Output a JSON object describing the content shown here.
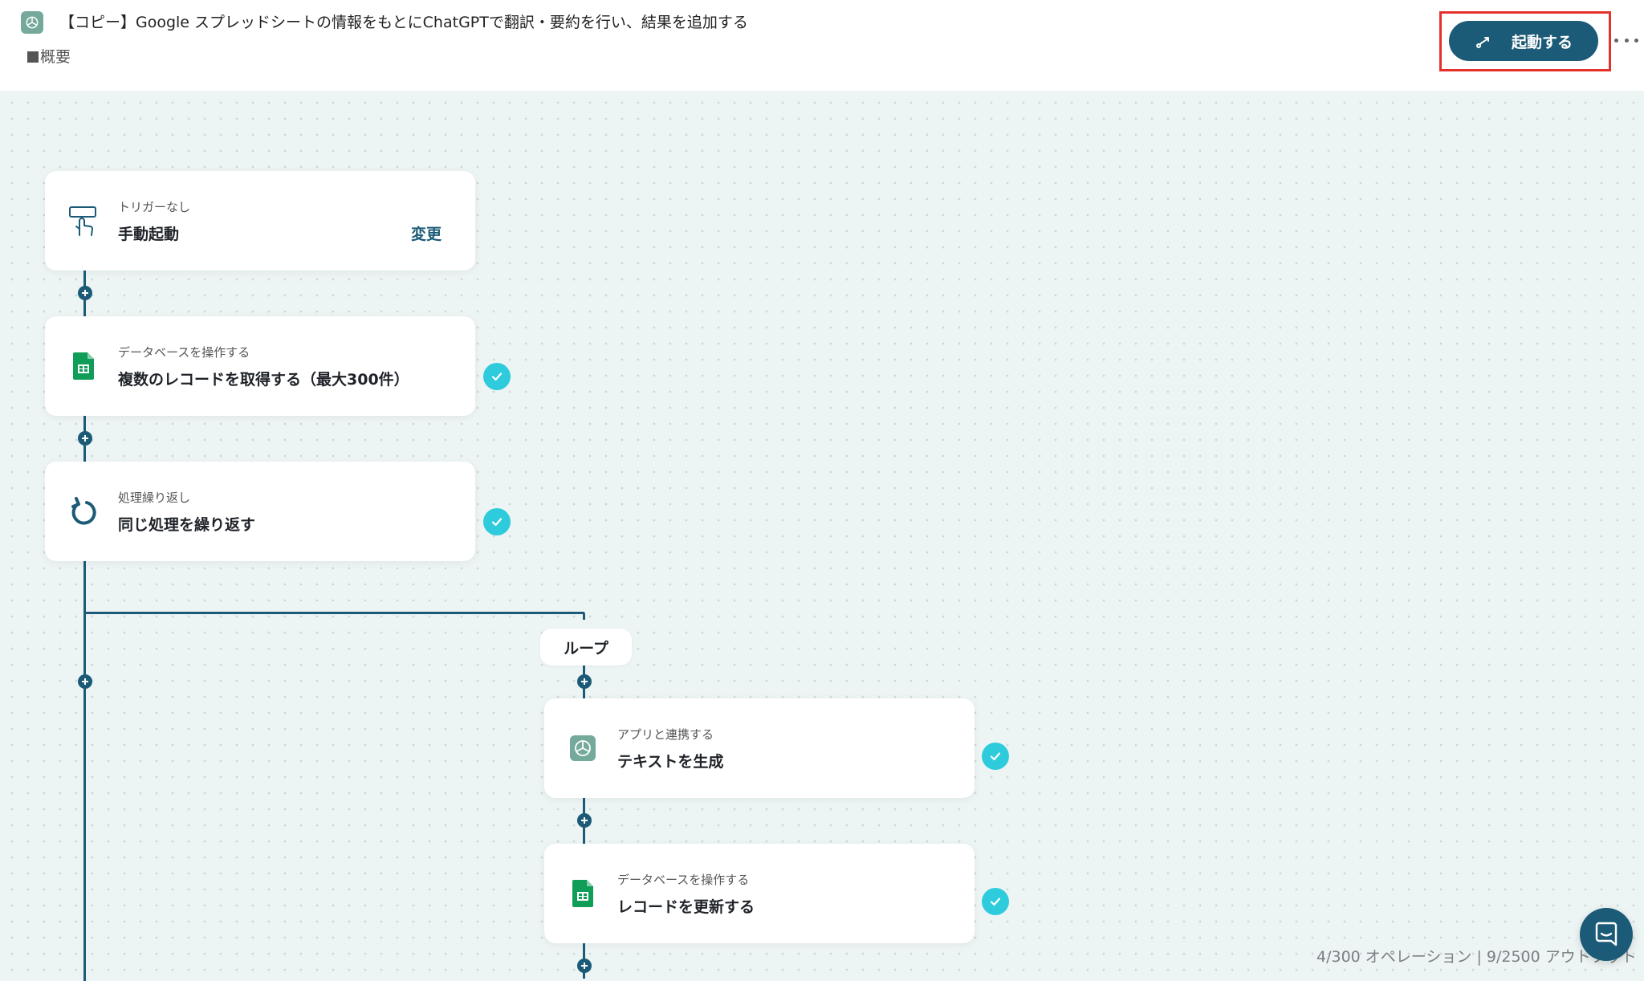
{
  "header": {
    "title": "【コピー】Google スプレッドシートの情報をもとにChatGPTで翻訳・要約を行い、結果を追加する",
    "overview_label": "概要",
    "start_button_label": "起動する"
  },
  "steps": [
    {
      "subtitle": "トリガーなし",
      "title": "手動起動",
      "action_label": "変更",
      "icon": "manual-trigger-icon"
    },
    {
      "subtitle": "データベースを操作する",
      "title": "複数のレコードを取得する（最大300件）",
      "icon": "google-sheets-icon",
      "status": "completed"
    },
    {
      "subtitle": "処理繰り返し",
      "title": "同じ処理を繰り返す",
      "icon": "loop-icon",
      "status": "completed"
    },
    {
      "subtitle": "アプリと連携する",
      "title": "テキストを生成",
      "icon": "chatgpt-icon",
      "status": "completed"
    },
    {
      "subtitle": "データベースを操作する",
      "title": "レコードを更新する",
      "icon": "google-sheets-icon",
      "status": "completed"
    }
  ],
  "loop_label": "ループ",
  "footer": {
    "stats": "4/300 オペレーション | 9/2500 アウトプット"
  },
  "colors": {
    "primary": "#1c5b77",
    "check": "#2ecbdc",
    "highlight": "#e4322b",
    "sheets_green": "#0f9d58"
  }
}
